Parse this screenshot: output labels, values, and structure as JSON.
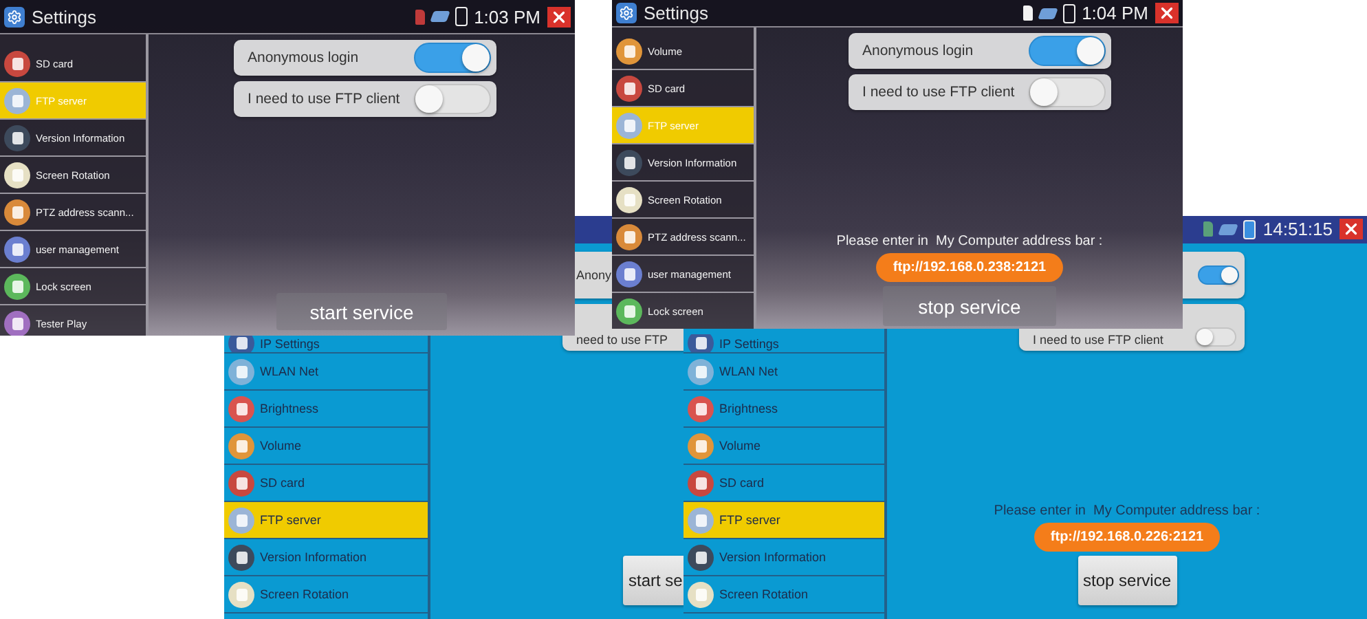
{
  "screens": [
    {
      "kind": "dark",
      "title": "Settings",
      "time": "1:03 PM",
      "menu": [
        {
          "label": "SD card",
          "color": "#c8483f",
          "selected": false
        },
        {
          "label": "FTP server",
          "color": "#9bb5d6",
          "selected": true
        },
        {
          "label": "Version Information",
          "color": "#3d4a5c",
          "selected": false
        },
        {
          "label": "Screen Rotation",
          "color": "#e6e0c4",
          "selected": false
        },
        {
          "label": "PTZ address scann...",
          "color": "#d98a3a",
          "selected": false
        },
        {
          "label": "user management",
          "color": "#6b7fd0",
          "selected": false
        },
        {
          "label": "Lock screen",
          "color": "#5cb85c",
          "selected": false
        },
        {
          "label": "Tester Play",
          "color": "#a06fc0",
          "selected": false
        }
      ],
      "options": [
        {
          "label": "Anonymous login",
          "on": true
        },
        {
          "label": "I need to use FTP client",
          "on": false
        }
      ],
      "service_button": "start service"
    },
    {
      "kind": "dark",
      "title": "Settings",
      "time": "1:04 PM",
      "menu": [
        {
          "label": "Volume",
          "color": "#e0953a",
          "selected": false
        },
        {
          "label": "SD card",
          "color": "#c8483f",
          "selected": false
        },
        {
          "label": "FTP server",
          "color": "#9bb5d6",
          "selected": true
        },
        {
          "label": "Version Information",
          "color": "#3d4a5c",
          "selected": false
        },
        {
          "label": "Screen Rotation",
          "color": "#e6e0c4",
          "selected": false
        },
        {
          "label": "PTZ address scann...",
          "color": "#d98a3a",
          "selected": false
        },
        {
          "label": "user management",
          "color": "#6b7fd0",
          "selected": false
        },
        {
          "label": "Lock screen",
          "color": "#5cb85c",
          "selected": false
        }
      ],
      "options": [
        {
          "label": "Anonymous login",
          "on": true
        },
        {
          "label": "I need to use FTP client",
          "on": false
        }
      ],
      "address_prompt": "Please enter in  My Computer address bar :",
      "address": "ftp://192.168.0.238:2121",
      "service_button": "stop service"
    },
    {
      "kind": "blue",
      "menu": [
        {
          "label": "IP Settings",
          "color": "#3a5a9a",
          "selected": false
        },
        {
          "label": "WLAN Net",
          "color": "#7fb2d8",
          "selected": false
        },
        {
          "label": "Brightness",
          "color": "#d9534f",
          "selected": false
        },
        {
          "label": "Volume",
          "color": "#e0953a",
          "selected": false
        },
        {
          "label": "SD card",
          "color": "#c8483f",
          "selected": false
        },
        {
          "label": "FTP server",
          "color": "#9bb5d6",
          "selected": true
        },
        {
          "label": "Version Information",
          "color": "#3d4a5c",
          "selected": false
        },
        {
          "label": "Screen Rotation",
          "color": "#e6e0c4",
          "selected": false
        }
      ],
      "options": [
        {
          "label": "Anony"
        },
        {
          "label": "need to use FTP"
        }
      ],
      "service_button": "start se"
    },
    {
      "kind": "blue",
      "time": "14:51:15",
      "menu": [
        {
          "label": "IP Settings",
          "color": "#3a5a9a",
          "selected": false
        },
        {
          "label": "WLAN Net",
          "color": "#7fb2d8",
          "selected": false
        },
        {
          "label": "Brightness",
          "color": "#d9534f",
          "selected": false
        },
        {
          "label": "Volume",
          "color": "#e0953a",
          "selected": false
        },
        {
          "label": "SD card",
          "color": "#c8483f",
          "selected": false
        },
        {
          "label": "FTP server",
          "color": "#9bb5d6",
          "selected": true
        },
        {
          "label": "Version Information",
          "color": "#3d4a5c",
          "selected": false
        },
        {
          "label": "Screen Rotation",
          "color": "#e6e0c4",
          "selected": false
        }
      ],
      "options": [
        {
          "on": true
        },
        {
          "label": "I need to use FTP client",
          "on": false
        }
      ],
      "address_prompt": "Please enter in  My Computer address bar :",
      "address": "ftp://192.168.0.226:2121",
      "service_button": "stop service"
    }
  ]
}
